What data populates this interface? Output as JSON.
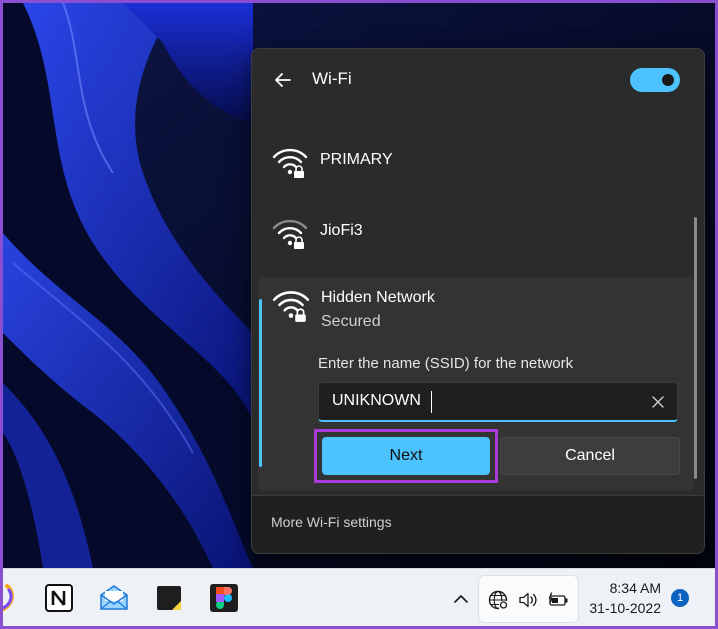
{
  "wifi_panel": {
    "title": "Wi-Fi",
    "toggle_on": true,
    "networks": [
      {
        "name": "PRIMARY"
      },
      {
        "name": "JioFi3"
      }
    ],
    "hidden_network": {
      "name": "Hidden Network",
      "status": "Secured",
      "ssid_label": "Enter the name (SSID) for the network",
      "ssid_value": "UNIKNOWN",
      "next_label": "Next",
      "cancel_label": "Cancel"
    },
    "more_settings": "More Wi-Fi settings"
  },
  "taskbar": {
    "apps": [
      "copilot-icon",
      "notion-icon",
      "mail-icon",
      "sticky-notes-icon",
      "figma-icon"
    ],
    "tray": [
      "globe-network-icon",
      "speaker-icon",
      "battery-charging-icon"
    ],
    "time": "8:34 AM",
    "date": "31-10-2022",
    "notification_count": "1"
  },
  "colors": {
    "accent": "#4cc2ff",
    "panel_bg": "#2b2b2b",
    "highlight": "#a93bd9",
    "taskbar_bg": "#eef1f6"
  }
}
